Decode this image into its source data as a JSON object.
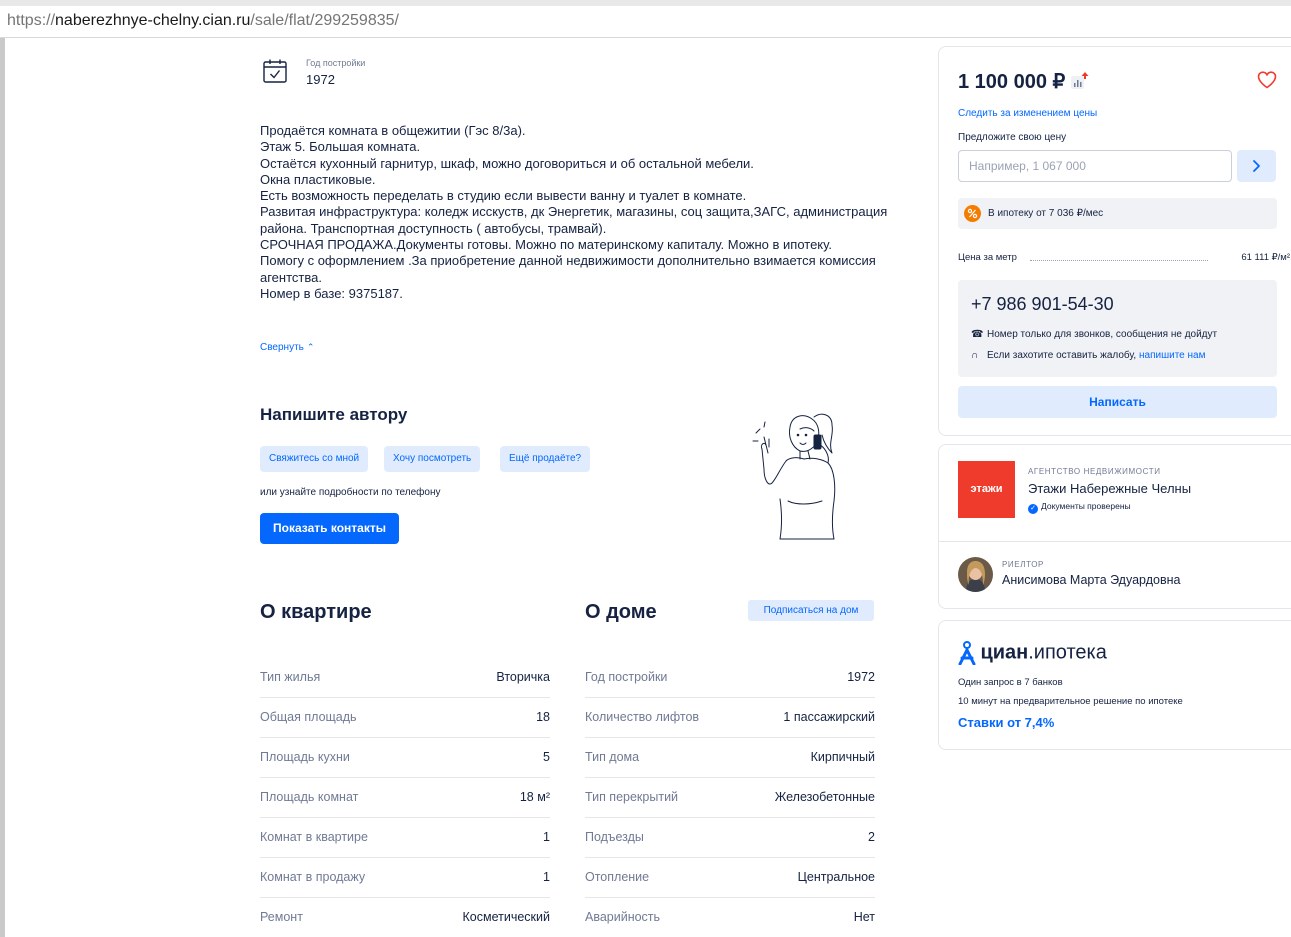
{
  "browser": {
    "url_scheme": "https://",
    "url_host": "naberezhnye-chelny.cian.ru",
    "url_path": "/sale/flat/299259835/"
  },
  "build_year": {
    "label": "Год постройки",
    "value": "1972",
    "icon": "calendar-check-icon"
  },
  "description": [
    "Продаётся комната в общежитии (Гэс 8/3а).",
    "Этаж 5. Большая комната.",
    "Остаётся кухонный гарнитур, шкаф, можно договориться и об остальной мебели.",
    "Окна пластиковые.",
    "Есть возможность переделать в студию если вывести ванну и туалет в комнате.",
    "Развитая инфраструктура: коледж исскуств, дк Энергетик, магазины, соц защита,ЗАГС, администрация района. Транспортная доступность ( автобусы, трамвай).",
    "СРОЧНАЯ ПРОДАЖА.Документы готовы. Можно по материнскому капиталу. Можно в ипотеку.",
    "Помогу с оформлением .За приобретение данной недвижимости дополнительно взимается комиссия агентства.",
    "Номер в базе: 9375187."
  ],
  "collapse_label": "Свернуть",
  "write_author": {
    "title": "Напишите автору",
    "chips": [
      "Свяжитесь со мной",
      "Хочу посмотреть",
      "Ещё продаёте?"
    ],
    "or_phone": "или узнайте подробности по телефону",
    "show_contacts": "Показать контакты"
  },
  "apartment": {
    "title": "О квартире",
    "rows": [
      {
        "key": "Тип жилья",
        "value": "Вторичка"
      },
      {
        "key": "Общая площадь",
        "value": "18"
      },
      {
        "key": "Площадь кухни",
        "value": "5"
      },
      {
        "key": "Площадь комнат",
        "value": "18 м²"
      },
      {
        "key": "Комнат в квартире",
        "value": "1"
      },
      {
        "key": "Комнат в продажу",
        "value": "1"
      },
      {
        "key": "Ремонт",
        "value": "Косметический"
      }
    ]
  },
  "house": {
    "title": "О доме",
    "subscribe": "Подписаться на дом",
    "rows": [
      {
        "key": "Год постройки",
        "value": "1972"
      },
      {
        "key": "Количество лифтов",
        "value": "1 пассажирский"
      },
      {
        "key": "Тип дома",
        "value": "Кирпичный"
      },
      {
        "key": "Тип перекрытий",
        "value": "Железобетонные"
      },
      {
        "key": "Подъезды",
        "value": "2"
      },
      {
        "key": "Отопление",
        "value": "Центральное"
      },
      {
        "key": "Аварийность",
        "value": "Нет"
      }
    ]
  },
  "price_card": {
    "price": "1 100 000 ₽",
    "track_price": "Следить за изменением цены",
    "offer_label": "Предложите свою цену",
    "offer_placeholder": "Например, 1 067 000",
    "mortgage_text": "В ипотеку от 7 036 ₽/мес",
    "per_meter_label": "Цена за метр",
    "per_meter_value": "61 111 ₽/м²",
    "phone": "+7 986 901-54-30",
    "phone_note": "Номер только для звонков, сообщения не дойдут",
    "complaint_text": "Если захотите оставить жалобу,",
    "complaint_link": "напишите нам",
    "write_button": "Написать",
    "colors": {
      "accent": "#0468ff",
      "favorite": "#ef3b2c",
      "mortgage_badge": "#f57c00"
    }
  },
  "agency": {
    "logo_text": "этажи",
    "type": "АГЕНТСТВО НЕДВИЖИМОСТИ",
    "name": "Этажи Набережные Челны",
    "verified": "Документы проверены",
    "realtor_type": "РИЕЛТОР",
    "realtor_name": "Анисимова Марта Эдуардовна"
  },
  "cian_mortgage": {
    "brand": "циан",
    "product": ".ипотека",
    "line1": "Один запрос в 7 банков",
    "line2": "10 минут на предварительное решение по ипотеке",
    "rates": "Ставки от 7,4%"
  }
}
